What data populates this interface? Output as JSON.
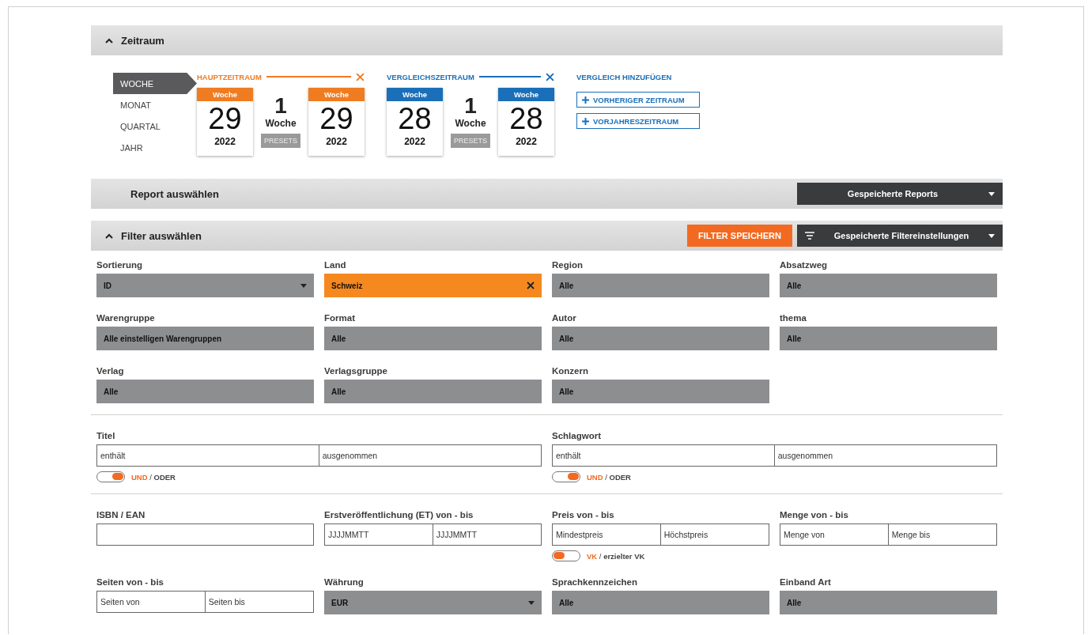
{
  "period_header": {
    "title": "Zeitraum",
    "expanded": true
  },
  "units": [
    {
      "label": "WOCHE",
      "selected": true
    },
    {
      "label": "MONAT",
      "selected": false
    },
    {
      "label": "QUARTAL",
      "selected": false
    },
    {
      "label": "JAHR",
      "selected": false
    }
  ],
  "ranges": [
    {
      "label": "HAUPTZEITRAUM",
      "color": "#f07c22",
      "start": {
        "unit": "Woche",
        "number": "29",
        "year": "2022"
      },
      "span_number": "1",
      "span_unit": "Woche",
      "presets": "PRESETS",
      "end": {
        "unit": "Woche",
        "number": "29",
        "year": "2022"
      }
    },
    {
      "label": "VERGLEICHSZEITRAUM",
      "color": "#1b6fb9",
      "start": {
        "unit": "Woche",
        "number": "28",
        "year": "2022"
      },
      "span_number": "1",
      "span_unit": "Woche",
      "presets": "PRESETS",
      "end": {
        "unit": "Woche",
        "number": "28",
        "year": "2022"
      }
    }
  ],
  "add_comparison": {
    "title": "VERGLEICH HINZUFÜGEN",
    "buttons": [
      "VORHERIGER ZEITRAUM",
      "VORJAHRESZEITRAUM"
    ]
  },
  "report_bar": {
    "title": "Report auswählen",
    "dropdown": "Gespeicherte Reports"
  },
  "filter_bar": {
    "title": "Filter auswählen",
    "expanded": true,
    "save_button": "FILTER SPEICHERN",
    "dropdown": "Gespeicherte Filtereinstellungen"
  },
  "filter_groups": [
    {
      "fields": [
        {
          "kind": "dropdown",
          "label": "Sortierung",
          "value": "ID",
          "highlighted": false
        },
        {
          "kind": "clearable",
          "label": "Land",
          "value": "Schweiz",
          "highlighted": true
        },
        {
          "kind": "select",
          "label": "Region",
          "value": "Alle",
          "highlighted": false
        },
        {
          "kind": "select",
          "label": "Absatzweg",
          "value": "Alle",
          "highlighted": false
        },
        {
          "kind": "select",
          "label": "Warengruppe",
          "value": "Alle einstelligen Warengruppen",
          "highlighted": false
        },
        {
          "kind": "select",
          "label": "Format",
          "value": "Alle",
          "highlighted": false
        },
        {
          "kind": "select",
          "label": "Autor",
          "value": "Alle",
          "highlighted": false
        },
        {
          "kind": "select",
          "label": "thema",
          "value": "Alle",
          "highlighted": false
        },
        {
          "kind": "select",
          "label": "Verlag",
          "value": "Alle",
          "highlighted": false
        },
        {
          "kind": "select",
          "label": "Verlagsgruppe",
          "value": "Alle",
          "highlighted": false
        },
        {
          "kind": "select",
          "label": "Konzern",
          "value": "Alle",
          "highlighted": false
        }
      ]
    },
    {
      "fields": [
        {
          "kind": "wide_range",
          "label": "Titel",
          "inputs": [
            {
              "placeholder": "enthält"
            },
            {
              "placeholder": "ausgenommen"
            }
          ],
          "toggle": {
            "on": true,
            "separator": "/",
            "options": [
              {
                "label": "UND",
                "selected": true
              },
              {
                "label": "ODER",
                "selected": false
              }
            ]
          }
        },
        {
          "kind": "wide_range",
          "label": "Schlagwort",
          "inputs": [
            {
              "placeholder": "enthält"
            },
            {
              "placeholder": "ausgenommen"
            }
          ],
          "toggle": {
            "on": true,
            "separator": "/",
            "options": [
              {
                "label": "UND",
                "selected": true
              },
              {
                "label": "ODER",
                "selected": false
              }
            ]
          }
        }
      ]
    },
    {
      "fields": [
        {
          "kind": "text",
          "label": "ISBN / EAN"
        },
        {
          "kind": "range",
          "label": "Erstveröffentlichung (ET) von - bis",
          "inputs": [
            {
              "placeholder": "JJJJMMTT"
            },
            {
              "placeholder": "JJJJMMTT"
            }
          ]
        },
        {
          "kind": "range",
          "label": "Preis von - bis",
          "inputs": [
            {
              "placeholder": "Mindestpreis"
            },
            {
              "placeholder": "Höchstpreis"
            }
          ],
          "toggle": {
            "on": false,
            "separator": "/",
            "options": [
              {
                "label": "VK",
                "selected": true
              },
              {
                "label": "erzielter VK",
                "selected": false
              }
            ]
          }
        },
        {
          "kind": "range",
          "label": "Menge von - bis",
          "inputs": [
            {
              "placeholder": "Menge von"
            },
            {
              "placeholder": "Menge bis"
            }
          ]
        },
        {
          "kind": "range",
          "label": "Seiten von - bis",
          "inputs": [
            {
              "placeholder": "Seiten von"
            },
            {
              "placeholder": "Seiten bis"
            }
          ]
        },
        {
          "kind": "dropdown",
          "label": "Währung",
          "value": "EUR",
          "highlighted": false
        },
        {
          "kind": "select",
          "label": "Sprachkennzeichen",
          "value": "Alle",
          "highlighted": false
        },
        {
          "kind": "select",
          "label": "Einband Art",
          "value": "Alle",
          "highlighted": false
        }
      ]
    }
  ]
}
